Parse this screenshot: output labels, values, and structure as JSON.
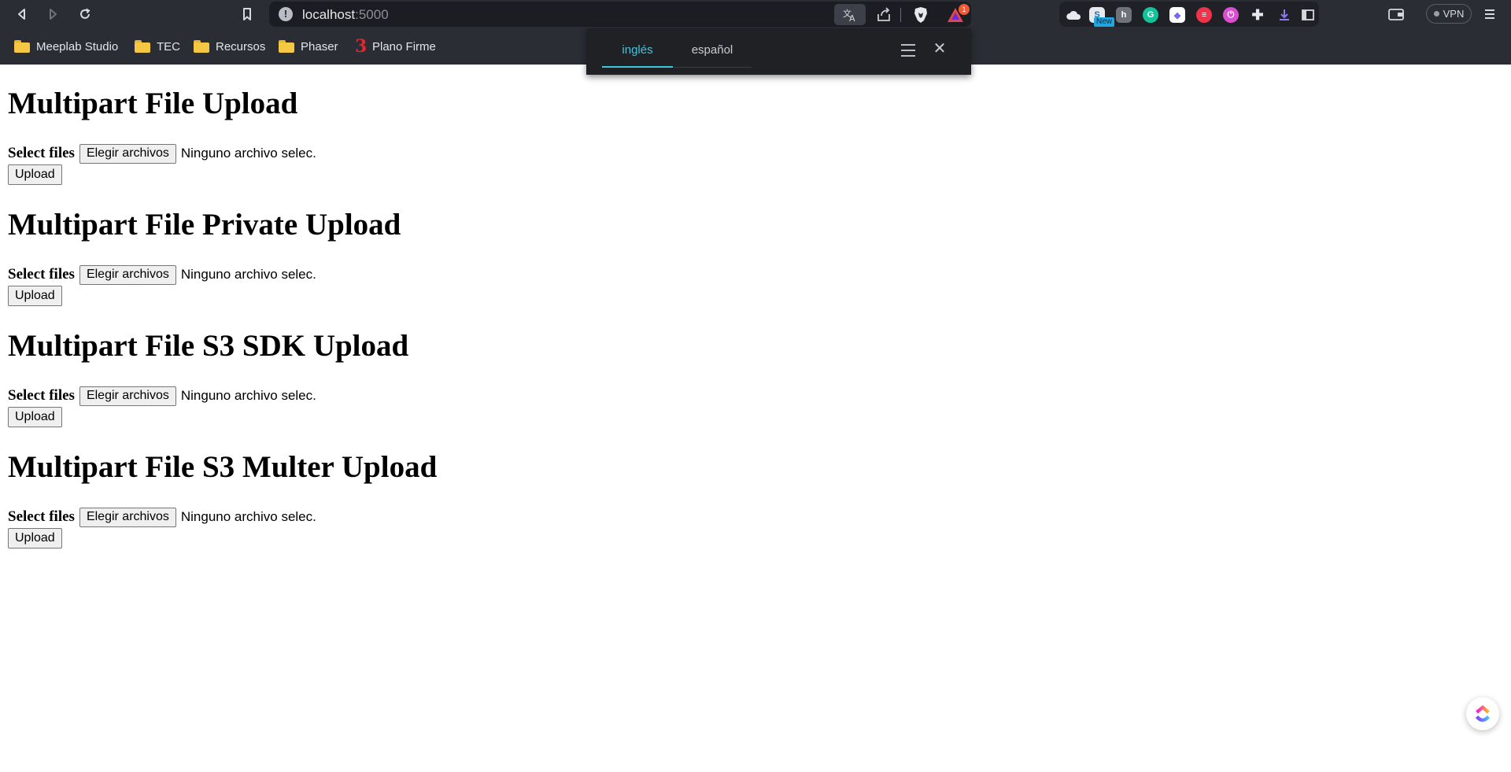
{
  "browser": {
    "url_host": "localhost",
    "url_port": ":5000",
    "rewards_badge": "1",
    "ext_new_tag": "New",
    "vpn_label": "VPN",
    "bookmarks": [
      {
        "label": "Meeplab Studio",
        "icon": "folder-icon"
      },
      {
        "label": "TEC",
        "icon": "folder-icon"
      },
      {
        "label": "Recursos",
        "icon": "folder-icon"
      },
      {
        "label": "Phaser",
        "icon": "folder-icon"
      },
      {
        "label": "Plano Firme",
        "icon": "plano-firme-favicon"
      }
    ],
    "colors": {
      "chrome_bg": "#2b2d35",
      "accent": "#3ec6e0"
    }
  },
  "translate_popup": {
    "tabs": [
      {
        "label": "inglés",
        "active": true
      },
      {
        "label": "español",
        "active": false
      }
    ]
  },
  "sections": [
    {
      "title": "Multipart File Upload",
      "select_label": "Select files",
      "choose_button": "Elegir archivos",
      "file_status": "Ninguno archivo selec.",
      "upload_button": "Upload"
    },
    {
      "title": "Multipart File Private Upload",
      "select_label": "Select files",
      "choose_button": "Elegir archivos",
      "file_status": "Ninguno archivo selec.",
      "upload_button": "Upload"
    },
    {
      "title": "Multipart File S3 SDK Upload",
      "select_label": "Select files",
      "choose_button": "Elegir archivos",
      "file_status": "Ninguno archivo selec.",
      "upload_button": "Upload"
    },
    {
      "title": "Multipart File S3 Multer Upload",
      "select_label": "Select files",
      "choose_button": "Elegir archivos",
      "file_status": "Ninguno archivo selec.",
      "upload_button": "Upload"
    }
  ]
}
